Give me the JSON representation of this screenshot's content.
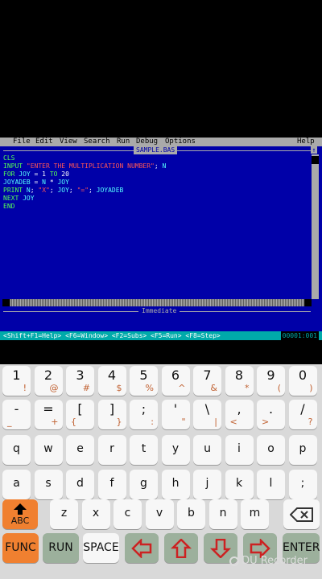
{
  "menu": {
    "items": [
      "File",
      "Edit",
      "View",
      "Search",
      "Run",
      "Debug",
      "Options"
    ],
    "help": "Help"
  },
  "editor": {
    "filename": "SAMPLE.BAS",
    "lines": [
      [
        {
          "t": "CLS",
          "c": "k"
        }
      ],
      [
        {
          "t": "INPUT ",
          "c": "k"
        },
        {
          "t": "\"ENTER THE MULTIPLICATION NUMBER\"",
          "c": "s"
        },
        {
          "t": "; ",
          "c": "n"
        },
        {
          "t": "N",
          "c": "v"
        }
      ],
      [
        {
          "t": "FOR ",
          "c": "k"
        },
        {
          "t": "JOY",
          "c": "v"
        },
        {
          "t": " = ",
          "c": "n"
        },
        {
          "t": "1",
          "c": "n"
        },
        {
          "t": " TO ",
          "c": "k"
        },
        {
          "t": "20",
          "c": "n"
        }
      ],
      [
        {
          "t": "JOYADEB",
          "c": "v"
        },
        {
          "t": " = ",
          "c": "n"
        },
        {
          "t": "N",
          "c": "v"
        },
        {
          "t": " * ",
          "c": "n"
        },
        {
          "t": "JOY",
          "c": "v"
        }
      ],
      [
        {
          "t": "PRINT ",
          "c": "k"
        },
        {
          "t": "N",
          "c": "v"
        },
        {
          "t": "; ",
          "c": "n"
        },
        {
          "t": "\"X\"",
          "c": "s"
        },
        {
          "t": "; ",
          "c": "n"
        },
        {
          "t": "JOY",
          "c": "v"
        },
        {
          "t": "; ",
          "c": "n"
        },
        {
          "t": "\"=\"",
          "c": "s"
        },
        {
          "t": "; ",
          "c": "n"
        },
        {
          "t": "JOYADEB",
          "c": "v"
        }
      ],
      [
        {
          "t": "NEXT ",
          "c": "k"
        },
        {
          "t": "JOY",
          "c": "v"
        }
      ],
      [
        {
          "t": "END",
          "c": "k"
        }
      ]
    ],
    "immediate_label": "Immediate"
  },
  "status": {
    "hint": "<Shift+F1=Help> <F6=Window> <F2=Subs> <F5=Run> <F8=Step>",
    "position": "00001:001"
  },
  "keyboard": {
    "row1": [
      [
        "1",
        "!"
      ],
      [
        "2",
        "@"
      ],
      [
        "3",
        "#"
      ],
      [
        "4",
        "$"
      ],
      [
        "5",
        "%"
      ],
      [
        "6",
        "^"
      ],
      [
        "7",
        "&"
      ],
      [
        "8",
        "*"
      ],
      [
        "9",
        "("
      ],
      [
        "0",
        ")"
      ]
    ],
    "row2": [
      [
        "-",
        "_"
      ],
      [
        "=",
        "+"
      ],
      [
        "[",
        "{"
      ],
      [
        "]",
        "}"
      ],
      [
        ";",
        ":"
      ],
      [
        "'",
        "\""
      ],
      [
        "\\",
        "|"
      ],
      [
        ",",
        "<"
      ],
      [
        ".",
        ">"
      ],
      [
        "/",
        "?"
      ]
    ],
    "row3": [
      "q",
      "w",
      "e",
      "r",
      "t",
      "y",
      "u",
      "i",
      "o",
      "p"
    ],
    "row4": [
      "a",
      "s",
      "d",
      "f",
      "g",
      "h",
      "j",
      "k",
      "l",
      ";"
    ],
    "row5": [
      "z",
      "x",
      "c",
      "v",
      "b",
      "n",
      "m"
    ],
    "shift_label": "ABC",
    "func_label": "FUNC",
    "run_label": "RUN",
    "space_label": "SPACE",
    "enter_label": "ENTER"
  },
  "recorder": {
    "label": "DU Recorder"
  },
  "colors": {
    "editor_bg": "#0000a8",
    "keyword": "#55ff55",
    "string": "#ff5555",
    "variable": "#55ffff",
    "status_bg": "#00aaaa",
    "func_key": "#f08030"
  }
}
